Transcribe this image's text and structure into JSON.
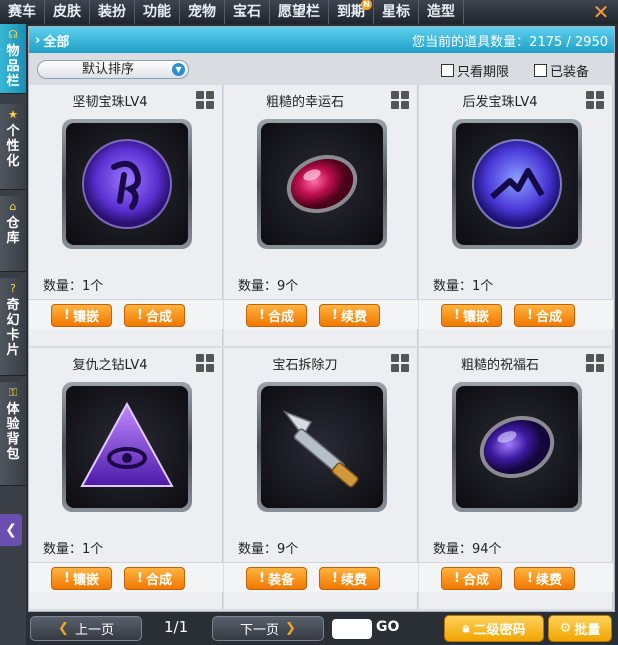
{
  "top_tabs": [
    {
      "label": "赛车"
    },
    {
      "label": "皮肤"
    },
    {
      "label": "装扮"
    },
    {
      "label": "功能"
    },
    {
      "label": "宠物"
    },
    {
      "label": "宝石"
    },
    {
      "label": "愿望栏"
    },
    {
      "label": "到期",
      "badge": "N"
    },
    {
      "label": "星标"
    },
    {
      "label": "造型"
    }
  ],
  "close_symbol": "✕",
  "side_tabs": [
    {
      "label": "物品栏",
      "icon": "bag-icon",
      "glyph": "☊"
    },
    {
      "label": "个性化",
      "icon": "star-icon",
      "glyph": "★"
    },
    {
      "label": "仓库",
      "icon": "house-icon",
      "glyph": "⌂"
    },
    {
      "label": "奇幻卡片",
      "icon": "card-icon",
      "glyph": "?"
    },
    {
      "label": "体验背包",
      "icon": "lock-icon",
      "glyph": "⚿"
    }
  ],
  "side_arrow": "❮",
  "header": {
    "breadcrumb": "全部",
    "count_text": "您当前的道具数量：2175 / 2950"
  },
  "filters": {
    "sort_label": "默认排序",
    "only_expiring": "只看期限",
    "equipped": "已装备"
  },
  "items": [
    {
      "name": "坚韧宝珠LV4",
      "qty": "数量：1个",
      "icon": "purple-orb-icon",
      "actions": [
        {
          "label": "镶嵌"
        },
        {
          "label": "合成"
        }
      ]
    },
    {
      "name": "粗糙的幸运石",
      "qty": "数量：9个",
      "icon": "red-gem-icon",
      "actions": [
        {
          "label": "合成"
        },
        {
          "label": "续费"
        }
      ]
    },
    {
      "name": "后发宝珠LV4",
      "qty": "数量：1个",
      "icon": "purple-orb-icon",
      "actions": [
        {
          "label": "镶嵌"
        },
        {
          "label": "合成"
        }
      ]
    },
    {
      "name": "复仇之钻LV4",
      "qty": "数量：1个",
      "icon": "purple-triangle-icon",
      "actions": [
        {
          "label": "镶嵌"
        },
        {
          "label": "合成"
        }
      ]
    },
    {
      "name": "宝石拆除刀",
      "qty": "数量：9个",
      "icon": "blade-icon",
      "actions": [
        {
          "label": "装备"
        },
        {
          "label": "续费"
        }
      ]
    },
    {
      "name": "粗糙的祝福石",
      "qty": "数量：94个",
      "icon": "blue-gem-icon",
      "actions": [
        {
          "label": "合成"
        },
        {
          "label": "续费"
        }
      ]
    }
  ],
  "pager": {
    "prev": "上一页",
    "next": "下一页",
    "indicator": "1/1",
    "go": "GO",
    "password": "二级密码",
    "batch": "批量"
  }
}
